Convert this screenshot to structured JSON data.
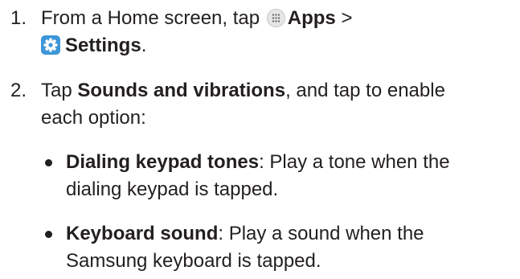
{
  "steps": [
    {
      "number": "1.",
      "line1_pre": "From a Home screen, tap",
      "apps_label": "Apps",
      "line1_post": ">",
      "settings_label": "Settings",
      "line2_post": "."
    },
    {
      "number": "2.",
      "tap_pre": "Tap",
      "sounds_label": "Sounds and vibrations",
      "tap_post": ", and tap to enable",
      "line2": "each option:"
    }
  ],
  "options": [
    {
      "term": "Dialing keypad tones",
      "desc_line1": ": Play a tone when the",
      "desc_line2": "dialing keypad is tapped."
    },
    {
      "term": "Keyboard sound",
      "desc_line1": ": Play a sound when the",
      "desc_line2": "Samsung keyboard is tapped."
    }
  ],
  "icons": {
    "apps": "apps-grid-icon",
    "settings": "settings-gear-icon",
    "settings_color": "#3d96d8"
  }
}
